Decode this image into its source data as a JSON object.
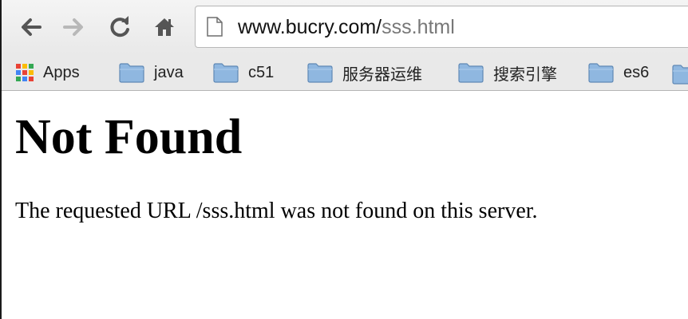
{
  "browser": {
    "url_host": "www.bucry.com/",
    "url_path": "sss.html",
    "icons": {
      "back": "arrow-left-icon",
      "forward": "arrow-right-icon",
      "reload": "reload-icon",
      "home": "home-icon",
      "page": "document-icon"
    }
  },
  "bookmarks": {
    "items": [
      {
        "label": "Apps",
        "icon": "apps-grid-icon"
      },
      {
        "label": "java",
        "icon": "folder-icon"
      },
      {
        "label": "c51",
        "icon": "folder-icon"
      },
      {
        "label": "服务器运维",
        "icon": "folder-icon"
      },
      {
        "label": "搜索引擎",
        "icon": "folder-icon"
      },
      {
        "label": "es6",
        "icon": "folder-icon"
      }
    ]
  },
  "page": {
    "heading": "Not Found",
    "message": "The requested URL /sss.html was not found on this server."
  },
  "colors": {
    "toolbar_bg": "#ececec",
    "url_host": "#111111",
    "url_path": "#777777",
    "folder_fill": "#8fb7e0",
    "apps_colors": [
      "#e94235",
      "#fbbc04",
      "#34a853",
      "#4285f4",
      "#e94235",
      "#fbbc04",
      "#34a853",
      "#4285f4",
      "#e94235"
    ]
  }
}
